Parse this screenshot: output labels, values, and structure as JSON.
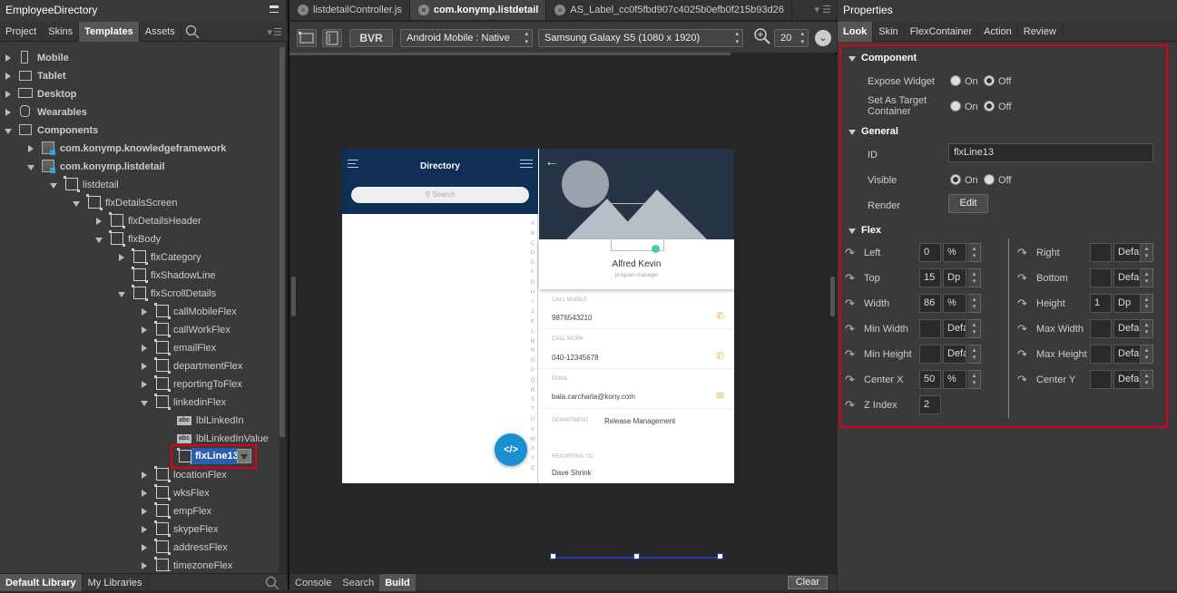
{
  "left": {
    "title": "EmployeeDirectory",
    "tabs": [
      "Project",
      "Skins",
      "Templates",
      "Assets"
    ],
    "tree": [
      {
        "label": "Mobile",
        "bold": true
      },
      {
        "label": "Tablet",
        "bold": true
      },
      {
        "label": "Desktop",
        "bold": true
      },
      {
        "label": "Wearables",
        "bold": true
      },
      {
        "label": "Components",
        "bold": true
      },
      {
        "label": "com.konymp.knowledgeframework",
        "bold": true
      },
      {
        "label": "com.konymp.listdetail",
        "bold": true
      },
      {
        "label": "listdetail"
      },
      {
        "label": "flxDetailsScreen"
      },
      {
        "label": "flxDetailsHeader"
      },
      {
        "label": "flxBody"
      },
      {
        "label": "flxCategory"
      },
      {
        "label": "flxShadowLine"
      },
      {
        "label": "flxScrollDetails"
      },
      {
        "label": "callMobileFlex"
      },
      {
        "label": "callWorkFlex"
      },
      {
        "label": "emailFlex"
      },
      {
        "label": "departmentFlex"
      },
      {
        "label": "reportingToFlex"
      },
      {
        "label": "linkedinFlex"
      },
      {
        "label": "lblLinkedIn"
      },
      {
        "label": "lblLinkedInValue"
      },
      {
        "label": "flxLine13"
      },
      {
        "label": "locationFlex"
      },
      {
        "label": "wksFlex"
      },
      {
        "label": "empFlex"
      },
      {
        "label": "skypeFlex"
      },
      {
        "label": "addressFlex"
      },
      {
        "label": "timezoneFlex"
      }
    ],
    "bottom_tabs": [
      "Default Library",
      "My Libraries"
    ]
  },
  "center": {
    "file_tabs": [
      "listdetailController.js",
      "com.konymp.listdetail",
      "AS_Label_cc0f5fbd907c4025b0efb0f215b93d26"
    ],
    "toolbar": {
      "bvr": "BVR",
      "platform": "Android Mobile : Native",
      "device": "Samsung Galaxy S5 (1080 x 1920)",
      "zoom": "20"
    },
    "preview": {
      "list_title": "Directory",
      "search_placeholder": "Search",
      "alphabet": [
        "A",
        "B",
        "C",
        "D",
        "E",
        "F",
        "G",
        "H",
        "I",
        "J",
        "K",
        "L",
        "M",
        "N",
        "O",
        "P",
        "Q",
        "R",
        "S",
        "T",
        "U",
        "V",
        "W",
        "X",
        "Y",
        "Z"
      ],
      "fab_label": "</>",
      "name": "Alfred Kevin",
      "role": "program manager",
      "fields": [
        {
          "label": "CALL MOBILE",
          "value": "9876543210",
          "icon": "phone-icon"
        },
        {
          "label": "CALL WORK",
          "value": "040-12345678",
          "icon": "phone-icon"
        },
        {
          "label": "EMAIL",
          "value": "bala.carcharla@kony.com",
          "icon": "mail-icon"
        },
        {
          "label": "DEPARTMENT",
          "value": "Release Management"
        },
        {
          "label": "REPORTING TO",
          "value": "Dave Shrink"
        }
      ]
    },
    "bottom_tabs": [
      "Console",
      "Search",
      "Build"
    ],
    "clear": "Clear"
  },
  "right": {
    "title": "Properties",
    "tabs": [
      "Look",
      "Skin",
      "FlexContainer",
      "Action",
      "Review"
    ],
    "component": {
      "section": "Component",
      "expose_widget": "Expose Widget",
      "set_as_target": "Set As Target Container",
      "on": "On",
      "off": "Off"
    },
    "general": {
      "section": "General",
      "id_label": "ID",
      "id_value": "flxLine13",
      "visible_label": "Visible",
      "render_label": "Render",
      "edit": "Edit"
    },
    "flex": {
      "section": "Flex",
      "left_col": [
        {
          "label": "Left",
          "value": "0",
          "unit": "%"
        },
        {
          "label": "Top",
          "value": "15",
          "unit": "Dp"
        },
        {
          "label": "Width",
          "value": "86",
          "unit": "%"
        },
        {
          "label": "Min Width",
          "value": "",
          "unit": "Default"
        },
        {
          "label": "Min Height",
          "value": "",
          "unit": "Default"
        },
        {
          "label": "Center X",
          "value": "50",
          "unit": "%"
        },
        {
          "label": "Z Index",
          "value": "2"
        }
      ],
      "right_col": [
        {
          "label": "Right",
          "value": "",
          "unit": "Default"
        },
        {
          "label": "Bottom",
          "value": "",
          "unit": "Default"
        },
        {
          "label": "Height",
          "value": "1",
          "unit": "Dp"
        },
        {
          "label": "Max Width",
          "value": "",
          "unit": "Default"
        },
        {
          "label": "Max Height",
          "value": "",
          "unit": "Default"
        },
        {
          "label": "Center Y",
          "value": "",
          "unit": "Default"
        }
      ]
    }
  }
}
